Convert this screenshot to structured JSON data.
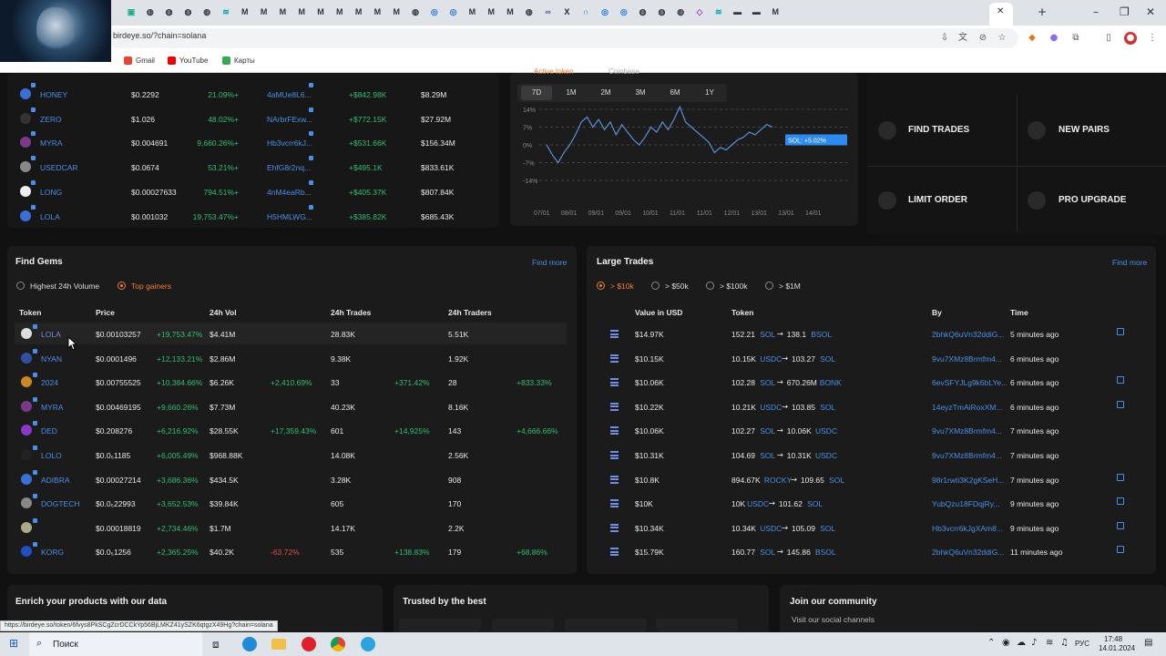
{
  "browser": {
    "url": "birdeye.so/?chain=solana",
    "bookmarks": [
      "Gmail",
      "YouTube",
      "Карты"
    ],
    "status_url": "https://birdeye.so/token/6fvys8PkSCgZcrDCCkYp56BjLMKZ41ySZK6qtgzX49Hg?chain=solana"
  },
  "trending": {
    "rows": [
      {
        "token": "HONEY",
        "price": "$0.2292",
        "change": "+21.09%",
        "addr": "4aMUe8L6...",
        "vol": "+$842.98K",
        "liq": "$8.29M"
      },
      {
        "token": "ZERO",
        "price": "$1.026",
        "change": "+48.02%",
        "addr": "NArbrFExw...",
        "vol": "+$772.15K",
        "liq": "$27.92M"
      },
      {
        "token": "MYRA",
        "price": "$0.004691",
        "change": "+9,660.26%",
        "addr": "Hb3vcrr6kJ...",
        "vol": "+$531.66K",
        "liq": "$156.34M"
      },
      {
        "token": "USEDCAR",
        "price": "$0.0674",
        "change": "+53.21%",
        "addr": "EhfG8r2nq...",
        "vol": "+$495.1K",
        "liq": "$833.61K"
      },
      {
        "token": "LONG",
        "price": "$0.00027633",
        "change": "+794.51%",
        "addr": "4nM4eaRb...",
        "vol": "+$405.37K",
        "liq": "$807.84K"
      },
      {
        "token": "LOLA",
        "price": "$0.001032",
        "change": "+19,753.47%",
        "addr": "H5HMLWG...",
        "vol": "+$385.82K",
        "liq": "$685.43K"
      }
    ]
  },
  "chart": {
    "top_labels": [
      "Active token",
      "Coinbase"
    ],
    "timeframes": [
      "7D",
      "1M",
      "2M",
      "3M",
      "6M",
      "1Y"
    ],
    "active_timeframe": "7D",
    "tooltip": "SOL: +5.02%",
    "accent": "#5b8fd6"
  },
  "chart_data": {
    "type": "line",
    "x": [
      "07/01",
      "08/01",
      "09/01",
      "09/01",
      "10/01",
      "11/01",
      "11/01",
      "12/01",
      "13/01",
      "13/01",
      "14/01"
    ],
    "yticks": [
      "14%",
      "7%",
      "0%",
      "-7%",
      "-14%"
    ],
    "ylim": [
      -14,
      14
    ],
    "series": [
      {
        "values": [
          0,
          -4,
          -7,
          -3,
          0,
          4,
          9,
          11,
          7,
          10,
          6,
          9,
          4,
          8,
          5,
          2,
          0,
          3,
          7,
          5,
          9,
          6,
          10,
          15,
          9,
          7,
          5,
          3,
          1,
          -3,
          -1,
          -2,
          0,
          2,
          3,
          5,
          4,
          6,
          8,
          7
        ]
      }
    ]
  },
  "quick": {
    "items": [
      "FIND TRADES",
      "NEW PAIRS",
      "LIMIT ORDER",
      "PRO UPGRADE"
    ]
  },
  "gems": {
    "title": "Find Gems",
    "find_more": "Find more",
    "filters": [
      "Highest 24h Volume",
      "Top gainers"
    ],
    "headers": [
      "Token",
      "Price",
      "24h Vol",
      "24h Trades",
      "24h Traders"
    ],
    "rows": [
      {
        "token": "LOLA",
        "price": "$0.00103257",
        "pct": "+19,753.47%",
        "vol": "$4.41M",
        "vol_pct": "",
        "trades": "28.83K",
        "trades_pct": "",
        "traders": "5.51K",
        "traders_pct": ""
      },
      {
        "token": "NYAN",
        "price": "$0.0001496",
        "pct": "+12,133.21%",
        "vol": "$2.86M",
        "vol_pct": "",
        "trades": "9.38K",
        "trades_pct": "",
        "traders": "1.92K",
        "traders_pct": ""
      },
      {
        "token": "2024",
        "price": "$0.00755525",
        "pct": "+10,384.66%",
        "vol": "$6.26K",
        "vol_pct": "+2,410.69%",
        "trades": "33",
        "trades_pct": "+371.42%",
        "traders": "28",
        "traders_pct": "+833.33%"
      },
      {
        "token": "MYRA",
        "price": "$0.00469195",
        "pct": "+9,660.26%",
        "vol": "$7.73M",
        "vol_pct": "",
        "trades": "40.23K",
        "trades_pct": "",
        "traders": "8.16K",
        "traders_pct": ""
      },
      {
        "token": "DED",
        "price": "$0.208276",
        "pct": "+6,216.92%",
        "vol": "$28.55K",
        "vol_pct": "+17,359.43%",
        "trades": "601",
        "trades_pct": "+14,925%",
        "traders": "143",
        "traders_pct": "+4,666.66%"
      },
      {
        "token": "LOLO",
        "price": "$0.0₅1185",
        "pct": "+6,005.49%",
        "vol": "$968.88K",
        "vol_pct": "",
        "trades": "14.08K",
        "trades_pct": "",
        "traders": "2.56K",
        "traders_pct": ""
      },
      {
        "token": "ADIBRA",
        "price": "$0.00027214",
        "pct": "+3,686.36%",
        "vol": "$434.5K",
        "vol_pct": "",
        "trades": "3.28K",
        "trades_pct": "",
        "traders": "908",
        "traders_pct": ""
      },
      {
        "token": "DOGTECH",
        "price": "$0.0₅22993",
        "pct": "+3,652.53%",
        "vol": "$39.84K",
        "vol_pct": "",
        "trades": "605",
        "trades_pct": "",
        "traders": "170",
        "traders_pct": ""
      },
      {
        "token": "",
        "price": "$0.00018819",
        "pct": "+2,734.46%",
        "vol": "$1.7M",
        "vol_pct": "",
        "trades": "14.17K",
        "trades_pct": "",
        "traders": "2.2K",
        "traders_pct": ""
      },
      {
        "token": "KORG",
        "price": "$0.0₅1256",
        "pct": "+2,365.25%",
        "vol": "$40.2K",
        "vol_pct": "-63.72%",
        "trades": "535",
        "trades_pct": "+138.83%",
        "traders": "179",
        "traders_pct": "+68.86%"
      }
    ]
  },
  "large": {
    "title": "Large Trades",
    "find_more": "Find more",
    "filters": [
      "> $10k",
      "> $50k",
      "> $100k",
      "> $1M"
    ],
    "headers": [
      "Value in USD",
      "Token",
      "By",
      "Time"
    ],
    "rows": [
      {
        "value": "$14.97K",
        "a": "152.21",
        "at": "SOL",
        "b": "138.1",
        "bt": "BSOL",
        "by": "2bhkQ6uVn32ddiG...",
        "time": "5 minutes ago"
      },
      {
        "value": "$10.15K",
        "a": "10.15K",
        "at": "USDC",
        "b": "103.27",
        "bt": "SOL",
        "by": "9vu7XMz8Brmfm4...",
        "time": "6 minutes ago"
      },
      {
        "value": "$10.06K",
        "a": "102.28",
        "at": "SOL",
        "b": "670.26M",
        "bt": "BONK",
        "by": "6evSFYJLg9k6bLYe...",
        "time": "6 minutes ago"
      },
      {
        "value": "$10.22K",
        "a": "10.21K",
        "at": "USDC",
        "b": "103.85",
        "bt": "SOL",
        "by": "14eyzTmAiRoxXM...",
        "time": "6 minutes ago"
      },
      {
        "value": "$10.06K",
        "a": "102.27",
        "at": "SOL",
        "b": "10.06K",
        "bt": "USDC",
        "by": "9vu7XMz8Brmfm4...",
        "time": "7 minutes ago"
      },
      {
        "value": "$10.31K",
        "a": "104.69",
        "at": "SOL",
        "b": "10.31K",
        "bt": "USDC",
        "by": "9vu7XMz8Brmfm4...",
        "time": "7 minutes ago"
      },
      {
        "value": "$10.8K",
        "a": "894.67K",
        "at": "ROCKY",
        "b": "109.65",
        "bt": "SOL",
        "by": "98r1rwti3K2gKSeH...",
        "time": "7 minutes ago"
      },
      {
        "value": "$10K",
        "a": "10K",
        "at": "USDC",
        "b": "101.62",
        "bt": "SOL",
        "by": "YubQzu18FDqjRy...",
        "time": "9 minutes ago"
      },
      {
        "value": "$10.34K",
        "a": "10.34K",
        "at": "USDC",
        "b": "105.09",
        "bt": "SOL",
        "by": "Hb3vcrr6kJgXAm8...",
        "time": "9 minutes ago"
      },
      {
        "value": "$15.79K",
        "a": "160.77",
        "at": "SOL",
        "b": "145.86",
        "bt": "BSOL",
        "by": "2bhkQ6uVn32ddiG...",
        "time": "11 minutes ago"
      }
    ]
  },
  "footer": {
    "enrich": "Enrich your products with our data",
    "trusted": "Trusted by the best",
    "community": "Join our community",
    "community_sub": "Visit our social channels"
  },
  "taskbar": {
    "search": "Поиск",
    "lang": "РУС",
    "time": "17:48",
    "date": "14.01.2024"
  }
}
